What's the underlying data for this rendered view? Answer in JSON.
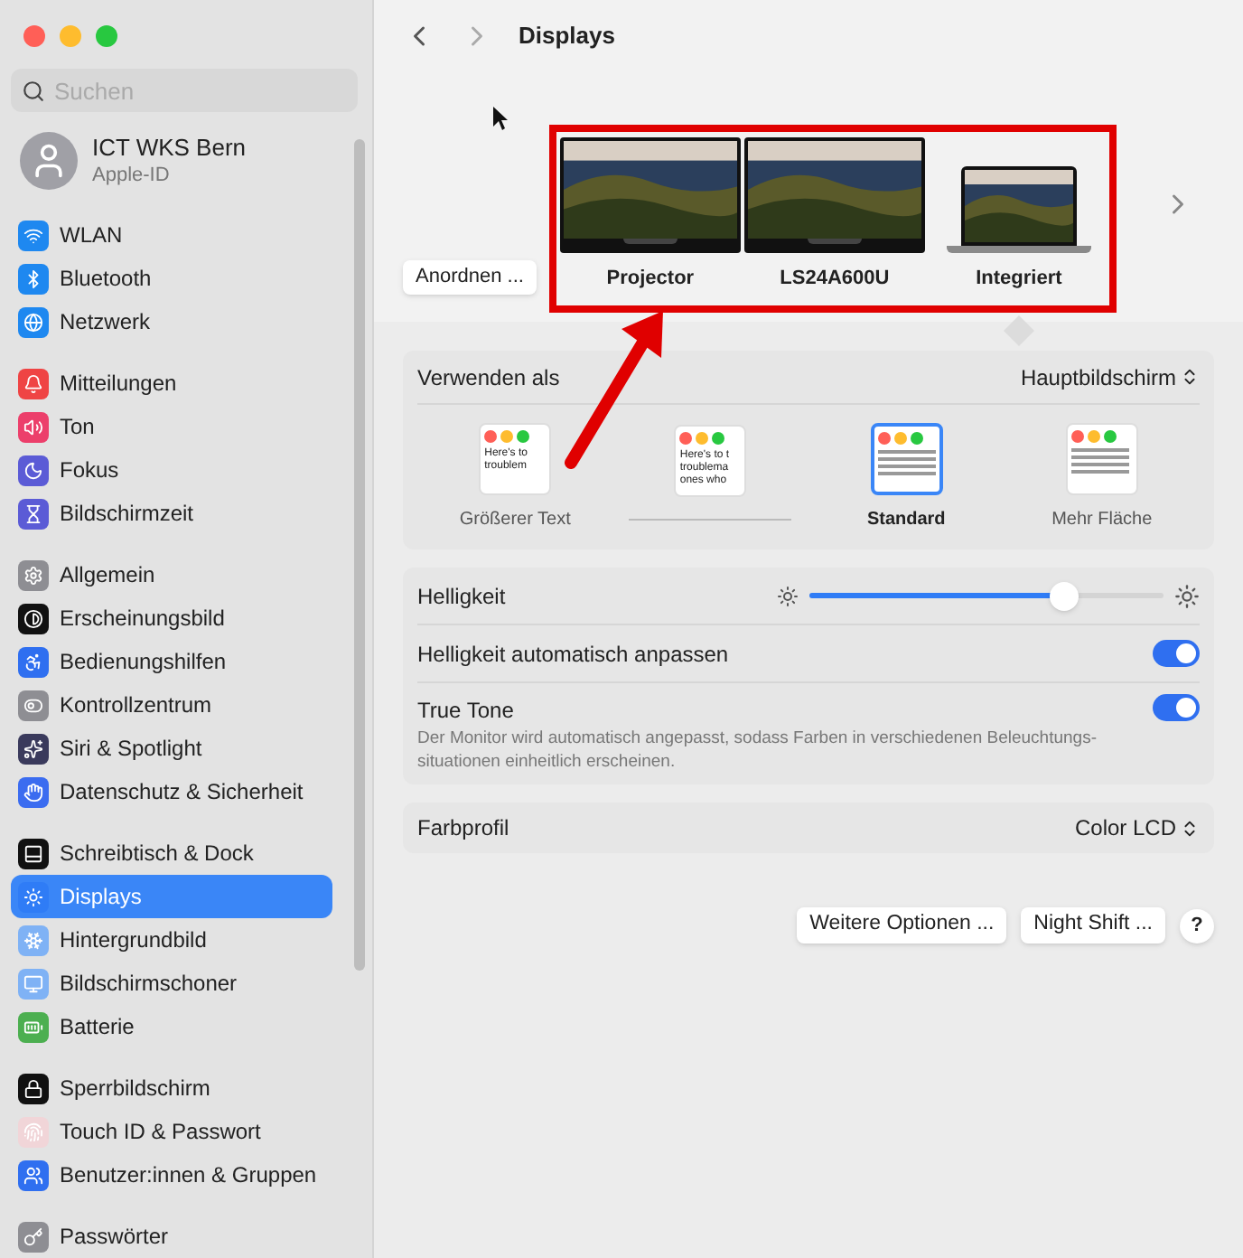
{
  "sidebar": {
    "search": {
      "placeholder": "Suchen"
    },
    "profile": {
      "name": "ICT WKS Bern",
      "subtitle": "Apple-ID"
    },
    "groups": [
      [
        {
          "label": "WLAN",
          "color": "#1e88f0",
          "selected": false
        },
        {
          "label": "Bluetooth",
          "color": "#1e88f0",
          "selected": false
        },
        {
          "label": "Netzwerk",
          "color": "#1e88f0",
          "selected": false
        }
      ],
      [
        {
          "label": "Mitteilungen",
          "color": "#ef4444",
          "selected": false
        },
        {
          "label": "Ton",
          "color": "#ec3f6b",
          "selected": false
        },
        {
          "label": "Fokus",
          "color": "#5b5bd6",
          "selected": false
        },
        {
          "label": "Bildschirmzeit",
          "color": "#5b5bd6",
          "selected": false
        }
      ],
      [
        {
          "label": "Allgemein",
          "color": "#8e8e93",
          "selected": false
        },
        {
          "label": "Erscheinungsbild",
          "color": "#111111",
          "selected": false
        },
        {
          "label": "Bedienungshilfen",
          "color": "#2f6ff0",
          "selected": false
        },
        {
          "label": "Kontrollzentrum",
          "color": "#8e8e93",
          "selected": false
        },
        {
          "label": "Siri & Spotlight",
          "color": "#3a3a5c",
          "selected": false
        },
        {
          "label": "Datenschutz & Sicherheit",
          "color": "#3b6cf0",
          "selected": false
        }
      ],
      [
        {
          "label": "Schreibtisch & Dock",
          "color": "#111111",
          "selected": false
        },
        {
          "label": "Displays",
          "color": "#2f7cf6",
          "selected": true
        },
        {
          "label": "Hintergrundbild",
          "color": "#7fb2f5",
          "selected": false
        },
        {
          "label": "Bildschirmschoner",
          "color": "#7fb2f5",
          "selected": false
        },
        {
          "label": "Batterie",
          "color": "#4caf50",
          "selected": false
        }
      ],
      [
        {
          "label": "Sperrbildschirm",
          "color": "#111111",
          "selected": false
        },
        {
          "label": "Touch ID & Passwort",
          "color": "#f1d5d8",
          "selected": false
        },
        {
          "label": "Benutzer:innen & Gruppen",
          "color": "#2f6ff0",
          "selected": false
        }
      ],
      [
        {
          "label": "Passwörter",
          "color": "#8e8e93",
          "selected": false
        }
      ]
    ]
  },
  "header": {
    "title": "Displays"
  },
  "arrange_button": "Anordnen ...",
  "displays": [
    {
      "name": "Projector",
      "kind": "monitor",
      "selected": false
    },
    {
      "name": "LS24A600U",
      "kind": "monitor",
      "selected": false
    },
    {
      "name": "Integriert",
      "kind": "laptop",
      "selected": true
    }
  ],
  "use_as": {
    "label": "Verwenden als",
    "value": "Hauptbildschirm"
  },
  "resolutions": [
    {
      "label": "Größerer Text",
      "preview_lines": [
        "Here's to",
        "troublem"
      ],
      "selected": false
    },
    {
      "preview_lines": [
        "Here's to t",
        "troublema",
        "ones who"
      ],
      "selected": false
    },
    {
      "label": "Standard",
      "selected": true
    },
    {
      "label": "Mehr Fläche",
      "selected": false
    }
  ],
  "brightness": {
    "label": "Helligkeit",
    "level": 0.72
  },
  "auto_brightness": {
    "label": "Helligkeit automatisch anpassen",
    "on": true
  },
  "true_tone": {
    "label": "True Tone",
    "description": "Der Monitor wird automatisch angepasst, sodass Farben in verschiedenen Beleuchtungs-situationen einheitlich erscheinen.",
    "on": true
  },
  "color_profile": {
    "label": "Farbprofil",
    "value": "Color LCD"
  },
  "buttons": [
    "Weitere Optionen ...",
    "Night Shift ..."
  ],
  "help": "?"
}
